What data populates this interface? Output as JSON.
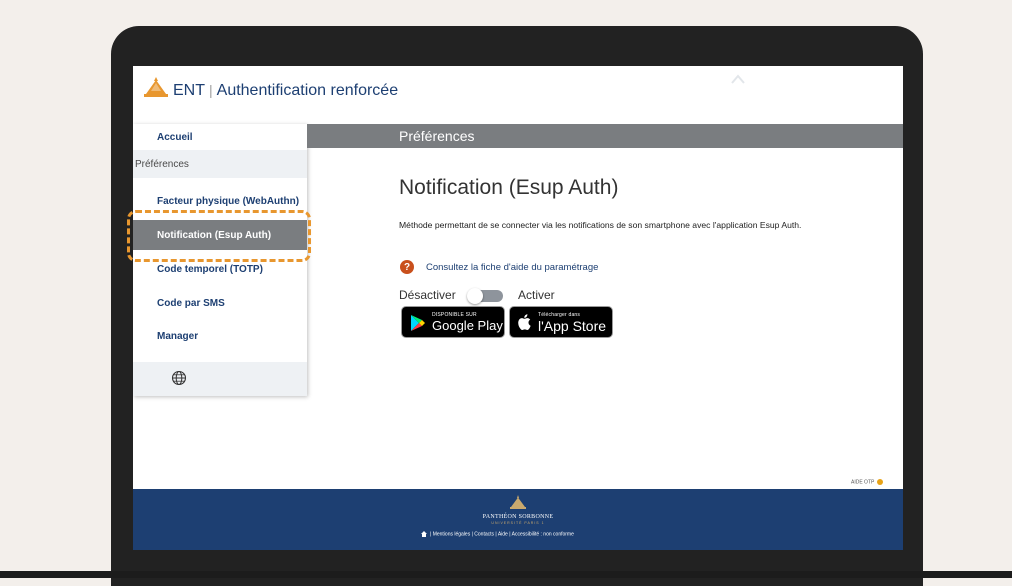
{
  "app": {
    "name": "ENT",
    "separator": "|",
    "subtitle": "Authentification renforcée"
  },
  "sidebar": {
    "home": "Accueil",
    "section_header": "Préférences",
    "items": [
      {
        "label": "Facteur physique (WebAuthn)",
        "active": false
      },
      {
        "label": "Notification (Esup Auth)",
        "active": true
      },
      {
        "label": "Code temporel (TOTP)",
        "active": false
      },
      {
        "label": "Code par SMS",
        "active": false
      },
      {
        "label": "Manager",
        "active": false
      }
    ],
    "footer_icon": "globe-icon"
  },
  "content": {
    "bar_title": "Préférences",
    "page_title": "Notification (Esup Auth)",
    "description": "Méthode permettant de se connecter via les notifications de son smartphone avec l'application Esup Auth.",
    "help_icon": "question-icon",
    "help_link": "Consultez la fiche d'aide du paramétrage",
    "toggle": {
      "off_label": "Désactiver",
      "on_label": "Activer",
      "enabled": false
    },
    "badges": {
      "google_play": {
        "small": "DISPONIBLE SUR",
        "big": "Google Play"
      },
      "app_store": {
        "small": "Télécharger dans",
        "big": "l'App Store"
      }
    }
  },
  "aide_otp": "AIDE OTP",
  "footer": {
    "brand": "PANTHÉON SORBONNE",
    "brand_sub": "UNIVERSITÉ PARIS 1",
    "links": "| Mentions légales | Contacts | Aide | Accessibilité : non conforme"
  },
  "colors": {
    "primary": "#1d3f72",
    "active_bg": "#7a7d80",
    "highlight": "#e8972f",
    "help": "#c9501c",
    "gold": "#c9a96e"
  }
}
